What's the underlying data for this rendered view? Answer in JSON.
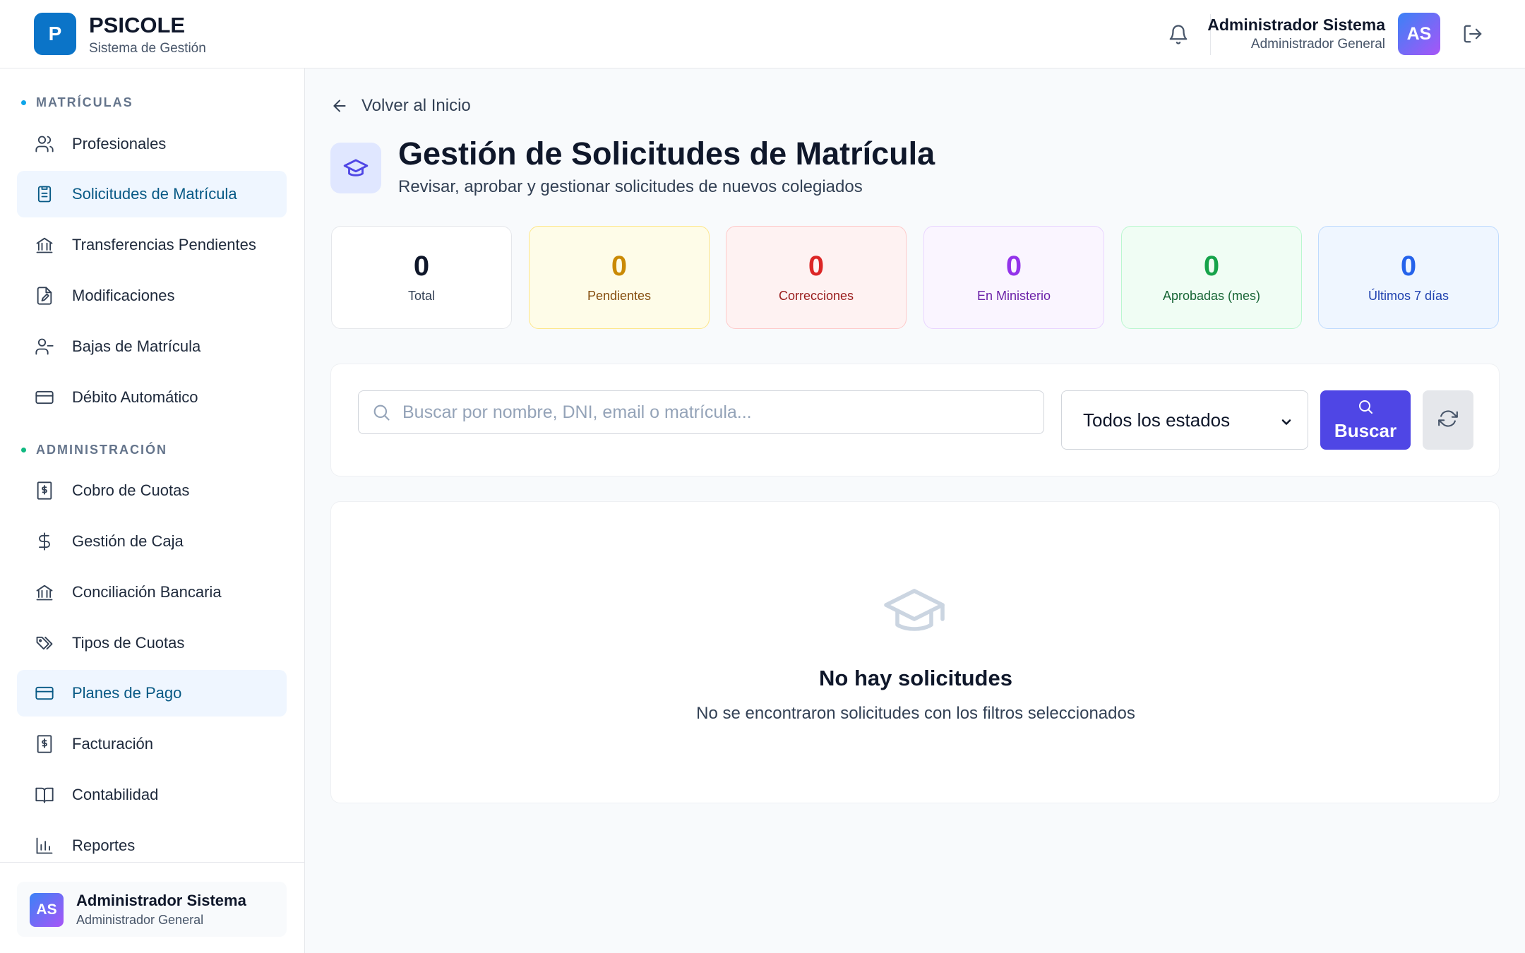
{
  "app": {
    "logo_letter": "P",
    "title": "PSICOLE",
    "subtitle": "Sistema de Gestión"
  },
  "header": {
    "user_name": "Administrador Sistema",
    "user_role": "Administrador General",
    "avatar_initials": "AS"
  },
  "sidebar": {
    "sections": [
      {
        "title": "MATRÍCULAS",
        "dot_color": "#0ea5e9",
        "items": [
          {
            "label": "Profesionales",
            "icon": "users-icon"
          },
          {
            "label": "Solicitudes de Matrícula",
            "icon": "clipboard-list-icon",
            "active": true
          },
          {
            "label": "Transferencias Pendientes",
            "icon": "bank-icon"
          },
          {
            "label": "Modificaciones",
            "icon": "file-edit-icon"
          },
          {
            "label": "Bajas de Matrícula",
            "icon": "user-minus-icon"
          },
          {
            "label": "Débito Automático",
            "icon": "credit-card-icon"
          }
        ]
      },
      {
        "title": "ADMINISTRACIÓN",
        "dot_color": "#10b981",
        "items": [
          {
            "label": "Cobro de Cuotas",
            "icon": "receipt-icon"
          },
          {
            "label": "Gestión de Caja",
            "icon": "dollar-icon"
          },
          {
            "label": "Conciliación Bancaria",
            "icon": "bank-icon"
          },
          {
            "label": "Tipos de Cuotas",
            "icon": "tags-icon"
          },
          {
            "label": "Planes de Pago",
            "icon": "credit-card-icon",
            "active": true
          },
          {
            "label": "Facturación",
            "icon": "receipt-icon"
          },
          {
            "label": "Contabilidad",
            "icon": "book-open-icon"
          },
          {
            "label": "Reportes",
            "icon": "bar-chart-icon"
          }
        ]
      }
    ],
    "footer": {
      "avatar_initials": "AS",
      "name": "Administrador Sistema",
      "role": "Administrador General"
    }
  },
  "main": {
    "back_label": "Volver al Inicio",
    "title": "Gestión de Solicitudes de Matrícula",
    "subtitle": "Revisar, aprobar y gestionar solicitudes de nuevos colegiados",
    "stats": [
      {
        "value": "0",
        "label": "Total",
        "bg": "#ffffff",
        "border": "#e5e7eb",
        "num_color": "#0f172a",
        "lbl_color": "#334155"
      },
      {
        "value": "0",
        "label": "Pendientes",
        "bg": "#fefce8",
        "border": "#fde68a",
        "num_color": "#ca8a04",
        "lbl_color": "#854d0e"
      },
      {
        "value": "0",
        "label": "Correcciones",
        "bg": "#fef2f2",
        "border": "#fecaca",
        "num_color": "#dc2626",
        "lbl_color": "#991b1b"
      },
      {
        "value": "0",
        "label": "En Ministerio",
        "bg": "#faf5ff",
        "border": "#e9d5ff",
        "num_color": "#9333ea",
        "lbl_color": "#6b21a8"
      },
      {
        "value": "0",
        "label": "Aprobadas (mes)",
        "bg": "#f0fdf4",
        "border": "#bbf7d0",
        "num_color": "#16a34a",
        "lbl_color": "#166534"
      },
      {
        "value": "0",
        "label": "Últimos 7 días",
        "bg": "#eff6ff",
        "border": "#bfdbfe",
        "num_color": "#2563eb",
        "lbl_color": "#1e40af"
      }
    ],
    "search": {
      "placeholder": "Buscar por nombre, DNI, email o matrícula...",
      "value": ""
    },
    "status_filter": {
      "selected": "Todos los estados"
    },
    "search_button_label": "Buscar",
    "empty_state": {
      "title": "No hay solicitudes",
      "message": "No se encontraron solicitudes con los filtros seleccionados"
    }
  },
  "colors": {
    "accent": "#4f46e5",
    "brand": "#0b74c8",
    "active_nav_bg": "#eff6ff",
    "active_nav_text": "#075985"
  }
}
